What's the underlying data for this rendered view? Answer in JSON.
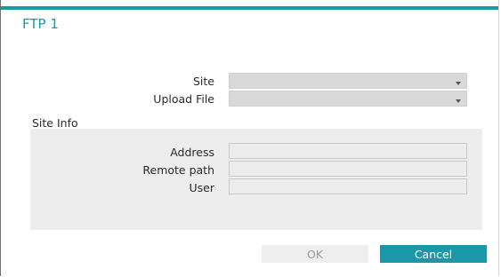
{
  "dialog": {
    "title": "FTP 1",
    "site": {
      "label": "Site",
      "value": ""
    },
    "upload_file": {
      "label": "Upload File",
      "value": ""
    },
    "site_info": {
      "label": "Site Info",
      "address": {
        "label": "Address",
        "value": ""
      },
      "remote_path": {
        "label": "Remote path",
        "value": ""
      },
      "user": {
        "label": "User",
        "value": ""
      }
    },
    "buttons": {
      "ok": "OK",
      "cancel": "Cancel"
    }
  },
  "colors": {
    "accent": "#1a98a9",
    "select_bg": "#d9d9d9",
    "panel_bg": "#ededed",
    "ok_disabled_bg": "#eeeeee"
  },
  "icons": {
    "dropdown": "chevron-down-icon"
  }
}
